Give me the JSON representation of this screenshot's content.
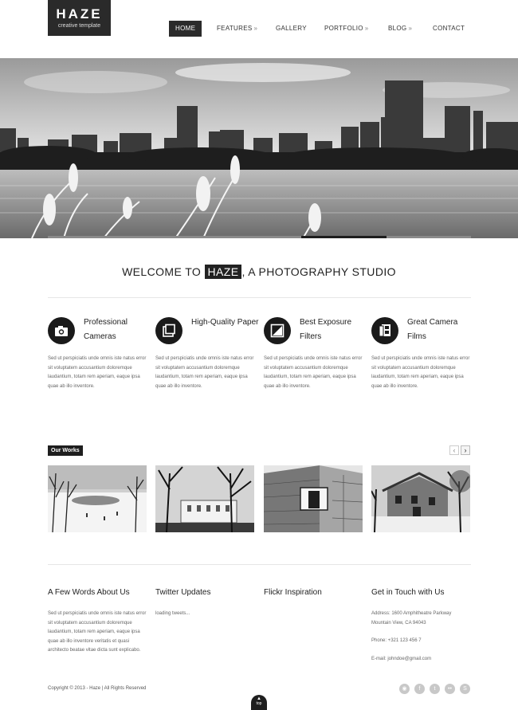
{
  "logo": {
    "name": "HAZE",
    "tagline": "creative template"
  },
  "nav": [
    {
      "label": "HOME",
      "dropdown": false
    },
    {
      "label": "FEATURES",
      "dropdown": true
    },
    {
      "label": "GALLERY",
      "dropdown": false
    },
    {
      "label": "PORTFOLIO",
      "dropdown": true
    },
    {
      "label": "BLOG",
      "dropdown": true
    },
    {
      "label": "CONTACT",
      "dropdown": false
    }
  ],
  "nav_arrow": "»",
  "welcome": {
    "before": "WELCOME TO ",
    "highlight": "HAZE",
    "after": ", A PHOTOGRAPHY STUDIO"
  },
  "features": [
    {
      "icon": "camera-icon",
      "title": "Professional Cameras",
      "text": "Sed ut perspiciatis unde omnis iste natus error sit voluptatem accusantium doloremque laudantium, totam rem aperiam, eaque ipsa quae ab illo inventore."
    },
    {
      "icon": "photo-paper-icon",
      "title": "High-Quality Paper",
      "text": "Sed ut perspiciatis unde omnis iste natus error sit voluptatem accusantium doloremque laudantium, totam rem aperiam, eaque ipsa quae ab illo inventore."
    },
    {
      "icon": "filter-icon",
      "title": "Best Exposure Filters",
      "text": "Sed ut perspiciatis unde omnis iste natus error sit voluptatem accusantium doloremque laudantium, totam rem aperiam, eaque ipsa quae ab illo inventore."
    },
    {
      "icon": "film-icon",
      "title": "Great Camera Films",
      "text": "Sed ut perspiciatis unde omnis iste natus error sit voluptatem accusantium doloremque laudantium, totam rem aperiam, eaque ipsa quae ab illo inventore."
    }
  ],
  "works": {
    "label": "Our Works",
    "prev": "‹",
    "next": "›"
  },
  "footer": {
    "about": {
      "title": "A Few Words About Us",
      "text": "Sed ut perspiciatis unde omnis iste natus error sit voluptatem accusantium doloremque laudantium, totam rem aperiam, eaque ipsa quae ab illo inventore veritatis et quasi architecto beatae vitae dicta sunt explicabo."
    },
    "twitter": {
      "title": "Twitter Updates",
      "text": "loading tweets..."
    },
    "flickr": {
      "title": "Flickr Inspiration"
    },
    "contact": {
      "title": "Get in Touch with Us",
      "address_line1": "Address: 1600 Amphitheatre Parkway",
      "address_line2": "Mountain View, CA 94043",
      "phone": "Phone: +321 123 456 7",
      "email": "E-mail: johndoe@gmail.com"
    },
    "copyright": "Copyright © 2013 - Haze | All Rights Reserved",
    "totop": "top"
  },
  "social": [
    {
      "icon": "rss-icon",
      "glyph": "◉"
    },
    {
      "icon": "facebook-icon",
      "glyph": "f"
    },
    {
      "icon": "twitter-icon",
      "glyph": "t"
    },
    {
      "icon": "flickr-icon",
      "glyph": "••"
    },
    {
      "icon": "skype-icon",
      "glyph": "S"
    }
  ]
}
